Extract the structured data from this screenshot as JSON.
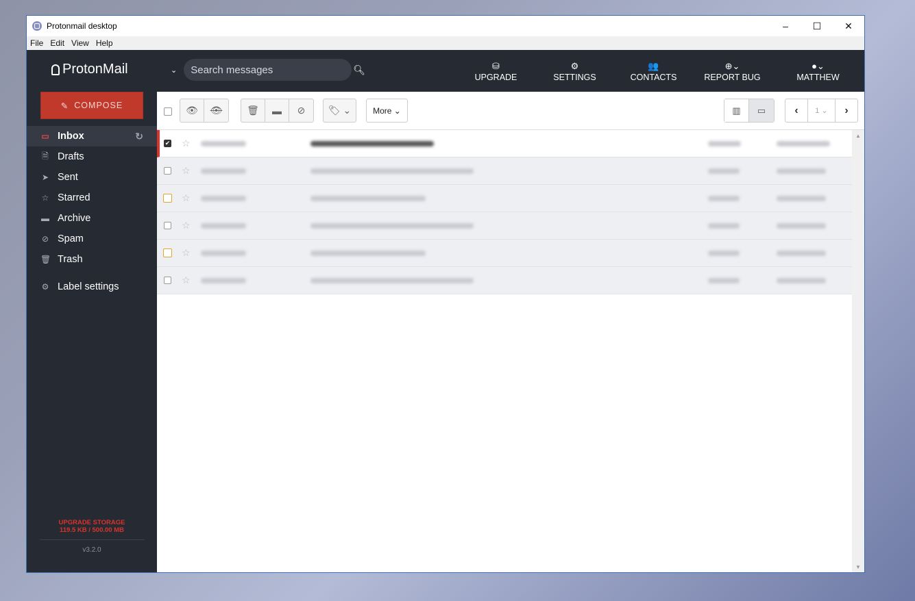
{
  "window": {
    "title": "Protonmail desktop",
    "minimize": "–",
    "maximize": "☐",
    "close": "✕"
  },
  "menu": [
    "File",
    "Edit",
    "View",
    "Help"
  ],
  "header": {
    "logo": "ProtonMail",
    "search_placeholder": "Search messages",
    "nav": [
      {
        "label": "UPGRADE",
        "icon": "upgrade-icon",
        "glyph": "⛁"
      },
      {
        "label": "SETTINGS",
        "icon": "settings-icon",
        "glyph": "⚙"
      },
      {
        "label": "CONTACTS",
        "icon": "contacts-icon",
        "glyph": "👥"
      },
      {
        "label": "REPORT BUG",
        "icon": "lifebuoy-icon",
        "glyph": "⊕⌄"
      },
      {
        "label": "MATTHEW",
        "icon": "user-icon",
        "glyph": "●⌄"
      }
    ]
  },
  "sidebar": {
    "compose": "COMPOSE",
    "folders": [
      {
        "label": "Inbox",
        "icon": "inbox-icon",
        "glyph": "▭"
      },
      {
        "label": "Drafts",
        "icon": "draft-icon",
        "glyph": "🗎"
      },
      {
        "label": "Sent",
        "icon": "paper-plane-icon",
        "glyph": "➤"
      },
      {
        "label": "Starred",
        "icon": "star-icon",
        "glyph": "☆"
      },
      {
        "label": "Archive",
        "icon": "archive-icon",
        "glyph": "▬"
      },
      {
        "label": "Spam",
        "icon": "ban-icon",
        "glyph": "⊘"
      },
      {
        "label": "Trash",
        "icon": "trash-icon",
        "glyph": "🗑"
      }
    ],
    "label_settings": "Label settings",
    "storage_title": "UPGRADE STORAGE",
    "storage_usage": "119.5 KB / 500.00 MB",
    "version": "v3.2.0"
  },
  "toolbar": {
    "more": "More",
    "page": "1"
  },
  "colors": {
    "accent": "#c0392b",
    "header_bg": "#262a33",
    "unread_marker": "#d9342b"
  }
}
